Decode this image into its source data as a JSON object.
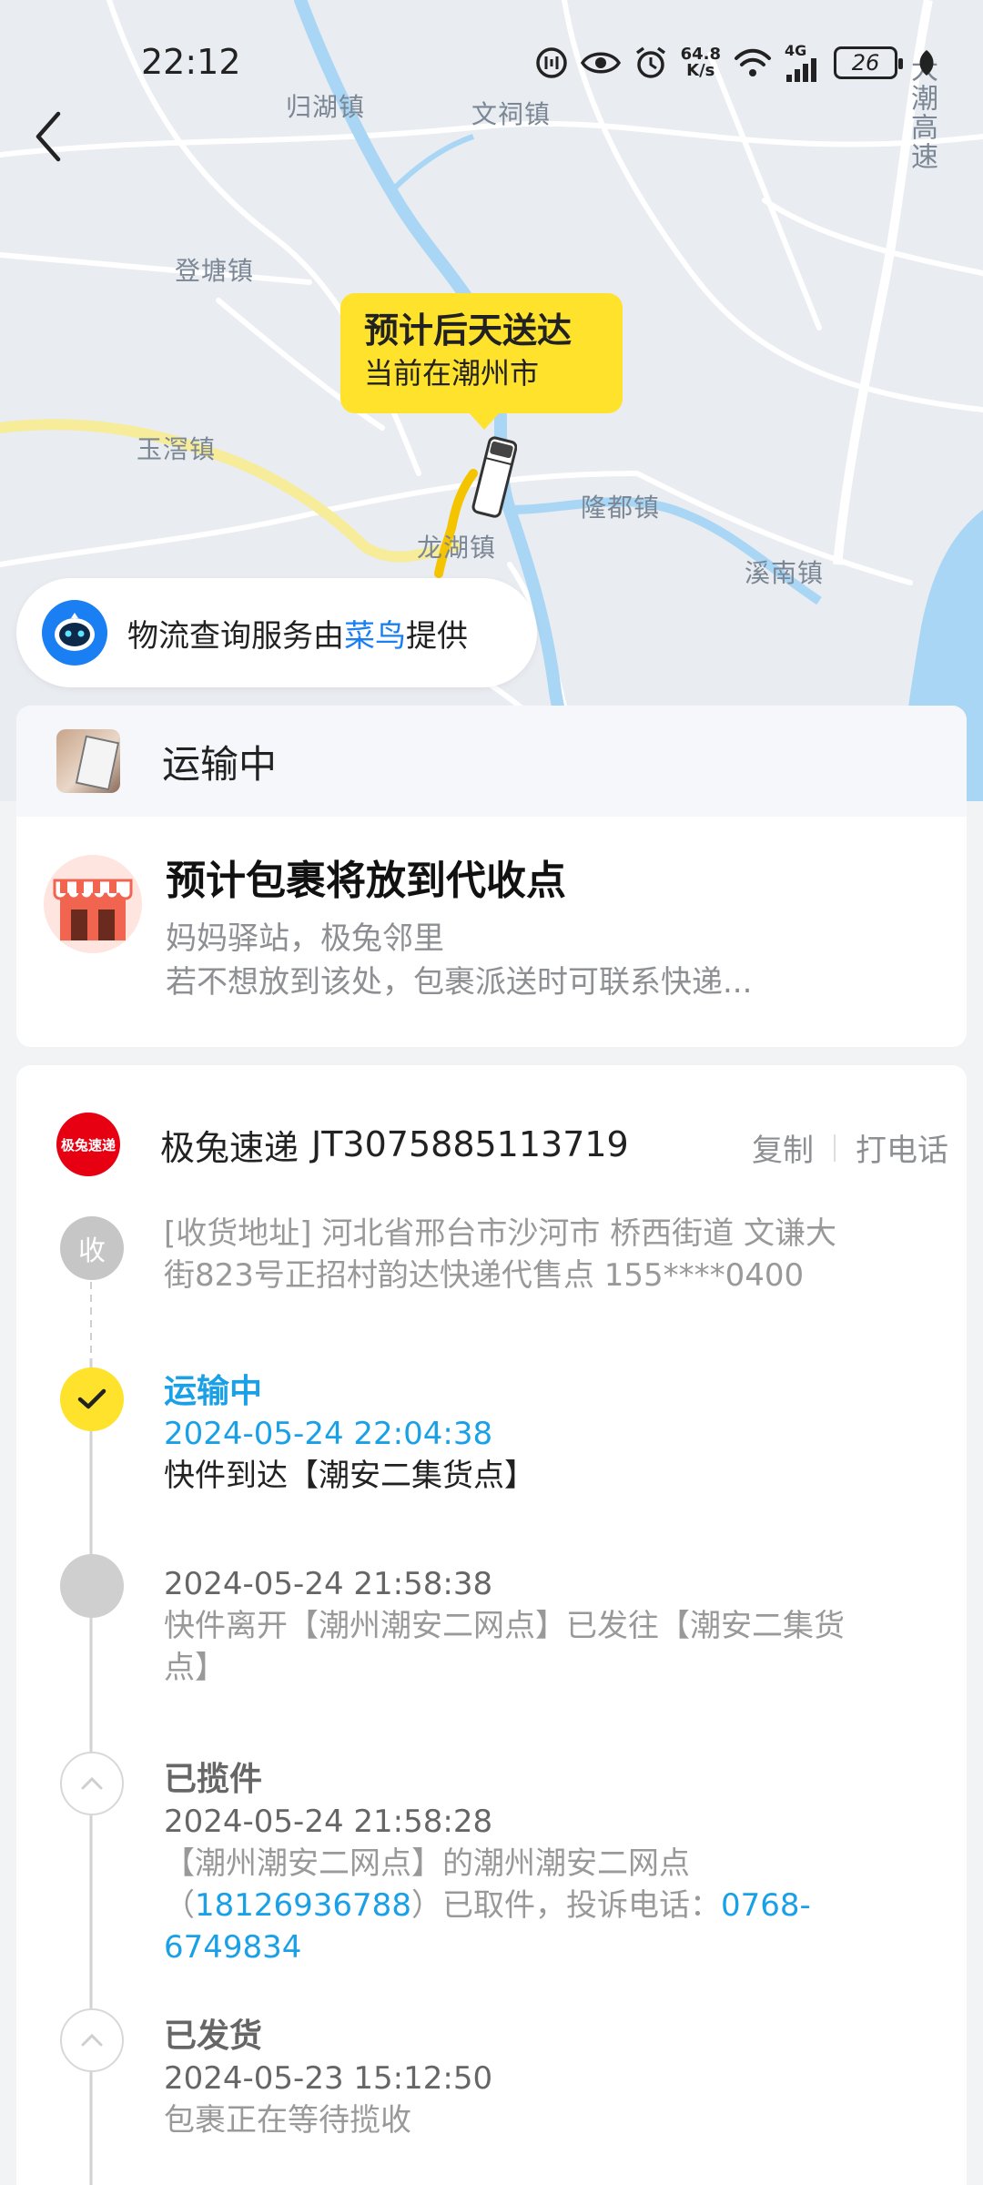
{
  "status_bar": {
    "time": "22:12",
    "net_speed_value": "64.8",
    "net_speed_unit": "K/s",
    "battery_level": "26",
    "network_type": "4G"
  },
  "map": {
    "labels": [
      "归湖镇",
      "文祠镇",
      "登塘镇",
      "玉滘镇",
      "隆都镇",
      "龙湖镇",
      "溪南镇"
    ],
    "side_label": "大潮高速",
    "eta_title": "预计后天送达",
    "eta_subtitle": "当前在潮州市"
  },
  "provider": {
    "prefix": "物流查询服务由",
    "name": "菜鸟",
    "suffix": "提供"
  },
  "summary": {
    "status": "运输中",
    "delivery_headline": "预计包裹将放到代收点",
    "delivery_point": "妈妈驿站，极兔邻里",
    "delivery_note": "若不想放到该处，包裹派送时可联系快递..."
  },
  "carrier": {
    "logo_text": "极兔速递",
    "name": "极兔速递",
    "tracking_no": "JT3075885113719",
    "copy_label": "复制",
    "call_label": "打电话"
  },
  "address": {
    "badge": "收",
    "line1": "[收货地址] 河北省邢台市沙河市 桥西街道 文谦大",
    "line2": "街823号正招村韵达快递代售点 155****0400"
  },
  "timeline": [
    {
      "title": "运输中",
      "time": "2024-05-24 22:04:38",
      "desc": "快件到达【潮安二集货点】"
    },
    {
      "time": "2024-05-24 21:58:38",
      "desc_line1": "快件离开【潮州潮安二网点】已发往【潮安二集货",
      "desc_line2": "点】"
    },
    {
      "title": "已揽件",
      "time": "2024-05-24 21:58:28",
      "desc_line1": "【潮州潮安二网点】的潮州潮安二网点",
      "desc_paren_open": "（",
      "phone": "18126936788",
      "desc_mid": "）已取件，投诉电话：",
      "complaint_phone_part1": "0768-",
      "complaint_phone_part2": "6749834"
    },
    {
      "title": "已发货",
      "time": "2024-05-23 15:12:50",
      "desc": "包裹正在等待揽收"
    }
  ],
  "colors": {
    "accent_yellow": "#ffe22c",
    "link_blue": "#1aa0e6",
    "cainiao_blue": "#1a7ff2",
    "carrier_red": "#e60012"
  }
}
